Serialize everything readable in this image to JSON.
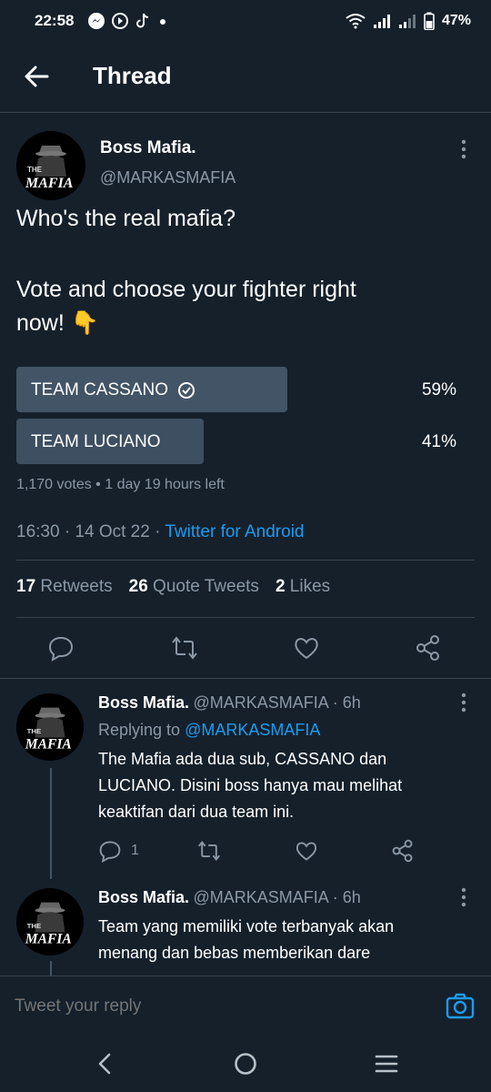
{
  "status_bar": {
    "time": "22:58",
    "battery": "47%",
    "icons": [
      "messenger-icon",
      "signal-app-icon",
      "tiktok-icon",
      "dot-icon",
      "wifi-icon",
      "cell-signal-icon",
      "cell-signal-2-icon",
      "battery-icon"
    ]
  },
  "header": {
    "title": "Thread"
  },
  "tweet": {
    "name": "Boss Mafia.",
    "handle": "@MARKASMAFIA",
    "text_line1": "Who's the real mafia?",
    "text_line2": "Vote and choose your fighter right",
    "text_line3": "now! 👇",
    "poll": [
      {
        "label": "TEAM CASSANO",
        "percent": "59%",
        "value": 59,
        "winner": true
      },
      {
        "label": "TEAM LUCIANO",
        "percent": "41%",
        "value": 41,
        "winner": false
      }
    ],
    "poll_meta": "1,170 votes • 1 day 19 hours left",
    "timestamp": "16:30 · 14 Oct 22 · ",
    "source": "Twitter for Android",
    "retweets_count": "17",
    "retweets_label": "Retweets",
    "quotes_count": "26",
    "quotes_label": "Quote Tweets",
    "likes_count": "2",
    "likes_label": "Likes"
  },
  "replies": [
    {
      "name": "Boss Mafia.",
      "handle_time": "@MARKASMAFIA · 6h",
      "replying_prefix": "Replying to ",
      "replying_handle": "@MARKASMAFIA",
      "line1": "The Mafia ada dua sub, CASSANO dan",
      "line2": "LUCIANO. Disini boss hanya mau melihat",
      "line3": "keaktifan dari dua team ini.",
      "reply_count": "1"
    },
    {
      "name": "Boss Mafia.",
      "handle_time": "@MARKASMAFIA · 6h",
      "line1": "Team yang memiliki vote terbanyak akan",
      "line2": "menang dan bebas memberikan dare"
    }
  ],
  "reply_box": {
    "placeholder": "Tweet your reply"
  },
  "avatar": {
    "text_the": "THE",
    "text_mafia": "MAFIA"
  },
  "colors": {
    "background": "#15202b",
    "accent": "#1d9bf0",
    "muted": "#8b98a5",
    "divider": "#38444d",
    "poll_bar": "#425466"
  }
}
